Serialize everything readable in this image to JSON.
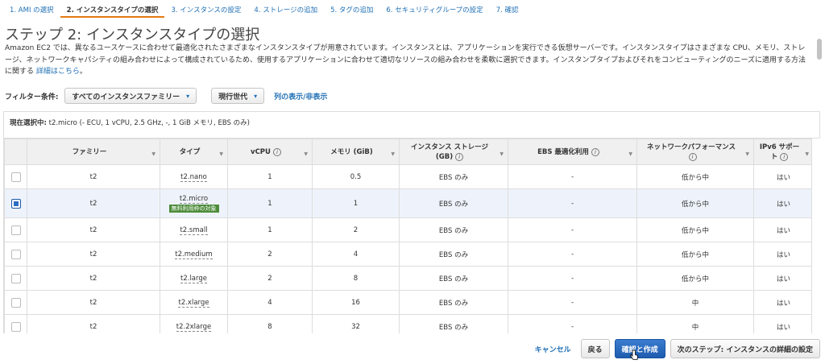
{
  "wizard": {
    "steps": [
      {
        "label": "1. AMI の選択"
      },
      {
        "label": "2. インスタンスタイプの選択"
      },
      {
        "label": "3. インスタンスの設定"
      },
      {
        "label": "4. ストレージの追加"
      },
      {
        "label": "5. タグの追加"
      },
      {
        "label": "6. セキュリティグループの設定"
      },
      {
        "label": "7. 確認"
      }
    ],
    "active_index": 1
  },
  "page": {
    "title": "ステップ 2: インスタンスタイプの選択",
    "description": "Amazon EC2 では、異なるユースケースに合わせて最適化されたさまざまなインスタンスタイプが用意されています。インスタンスとは、アプリケーションを実行できる仮想サーバーです。インスタンスタイプはさまざまな CPU、メモリ、ストレージ、ネットワークキャパシティの組み合わせによって構成されているため、使用するアプリケーションに合わせて適切なリソースの組み合わせを柔軟に選択できます。インスタンプタイプおよびそれをコンピューティングのニーズに適用する方法に関する",
    "learn_more": "詳細はこちら",
    "learn_more_suffix": "。"
  },
  "filter": {
    "label": "フィルター条件:",
    "family_select": "すべてのインスタンスファミリー",
    "generation_select": "現行世代",
    "column_toggle": "列の表示/非表示"
  },
  "current_selection": {
    "label": "現在選択中:",
    "value": "t2.micro (- ECU, 1 vCPU, 2.5 GHz, -, 1 GiB メモリ, EBS のみ)"
  },
  "table": {
    "headers": {
      "family": "ファミリー",
      "type": "タイプ",
      "vcpu": "vCPU",
      "memory": "メモリ (GiB)",
      "storage_line1": "インスタンス ストレージ",
      "storage_line2": "(GB)",
      "ebs": "EBS 最適化利用",
      "network": "ネットワークパフォーマンス",
      "ipv6_line1": "IPv6 サポー",
      "ipv6_line2": "ト"
    },
    "free_tier_badge": "無料利用枠の対象",
    "rows": [
      {
        "family": "t2",
        "type": "t2.nano",
        "vcpu": "1",
        "memory": "0.5",
        "storage": "EBS のみ",
        "ebs": "-",
        "network": "低から中",
        "ipv6": "はい",
        "selected": false
      },
      {
        "family": "t2",
        "type": "t2.micro",
        "vcpu": "1",
        "memory": "1",
        "storage": "EBS のみ",
        "ebs": "-",
        "network": "低から中",
        "ipv6": "はい",
        "selected": true
      },
      {
        "family": "t2",
        "type": "t2.small",
        "vcpu": "1",
        "memory": "2",
        "storage": "EBS のみ",
        "ebs": "-",
        "network": "低から中",
        "ipv6": "はい",
        "selected": false
      },
      {
        "family": "t2",
        "type": "t2.medium",
        "vcpu": "2",
        "memory": "4",
        "storage": "EBS のみ",
        "ebs": "-",
        "network": "低から中",
        "ipv6": "はい",
        "selected": false
      },
      {
        "family": "t2",
        "type": "t2.large",
        "vcpu": "2",
        "memory": "8",
        "storage": "EBS のみ",
        "ebs": "-",
        "network": "低から中",
        "ipv6": "はい",
        "selected": false
      },
      {
        "family": "t2",
        "type": "t2.xlarge",
        "vcpu": "4",
        "memory": "16",
        "storage": "EBS のみ",
        "ebs": "-",
        "network": "中",
        "ipv6": "はい",
        "selected": false
      },
      {
        "family": "t2",
        "type": "t2.2xlarge",
        "vcpu": "8",
        "memory": "32",
        "storage": "EBS のみ",
        "ebs": "-",
        "network": "中",
        "ipv6": "はい",
        "selected": false
      }
    ]
  },
  "footer": {
    "cancel": "キャンセル",
    "back": "戻る",
    "review_launch": "確認と作成",
    "next": "次のステップ: インスタンスの詳細の設定"
  },
  "colors": {
    "accent": "#e47911",
    "link": "#1f6fb5",
    "primary_button": "#1d5cae",
    "free_badge": "#4d8c3a"
  }
}
